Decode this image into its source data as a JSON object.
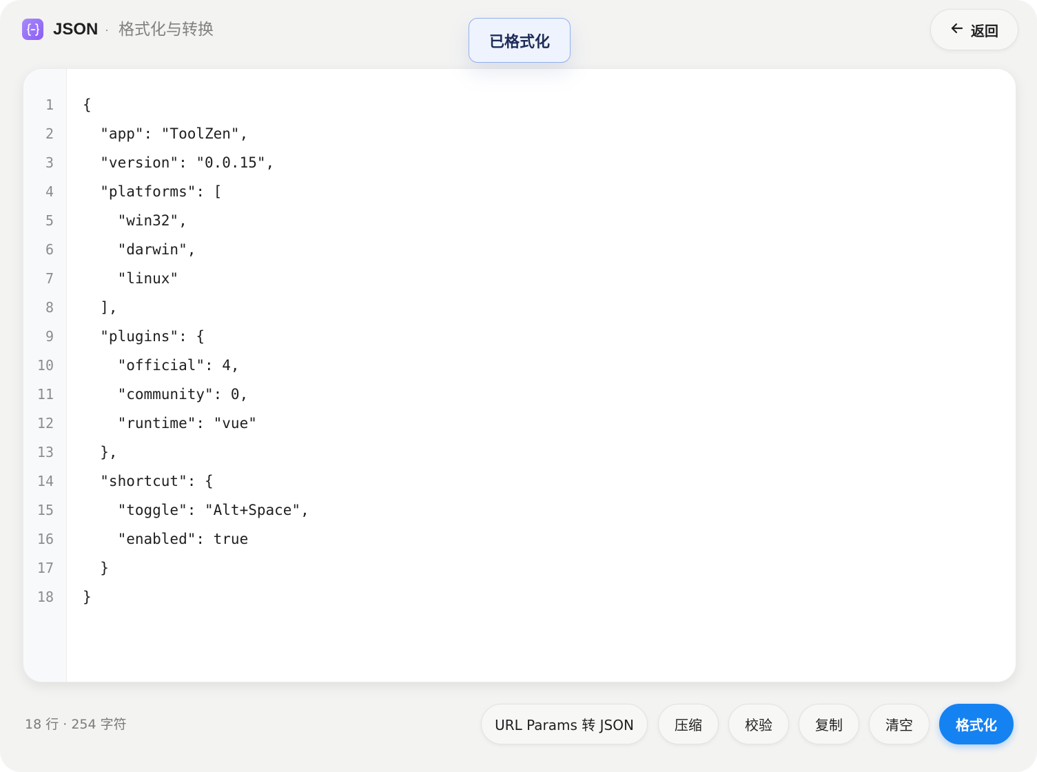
{
  "header": {
    "app_name": "JSON",
    "separator": "·",
    "subtitle": "格式化与转换",
    "back_label": "返回"
  },
  "toast": {
    "message": "已格式化"
  },
  "editor": {
    "line_numbers": [
      "1",
      "2",
      "3",
      "4",
      "5",
      "6",
      "7",
      "8",
      "9",
      "10",
      "11",
      "12",
      "13",
      "14",
      "15",
      "16",
      "17",
      "18"
    ],
    "lines": [
      "{",
      "  \"app\": \"ToolZen\",",
      "  \"version\": \"0.0.15\",",
      "  \"platforms\": [",
      "    \"win32\",",
      "    \"darwin\",",
      "    \"linux\"",
      "  ],",
      "  \"plugins\": {",
      "    \"official\": 4,",
      "    \"community\": 0,",
      "    \"runtime\": \"vue\"",
      "  },",
      "  \"shortcut\": {",
      "    \"toggle\": \"Alt+Space\",",
      "    \"enabled\": true",
      "  }",
      "}"
    ]
  },
  "footer": {
    "stats": "18 行 · 254 字符",
    "buttons": {
      "url_params": "URL Params 转 JSON",
      "compress": "压缩",
      "validate": "校验",
      "copy": "复制",
      "clear": "清空",
      "format": "格式化"
    }
  },
  "colors": {
    "accent": "#1582f2",
    "icon": "#8b5cf6",
    "toast_border": "#8fb0ee"
  }
}
